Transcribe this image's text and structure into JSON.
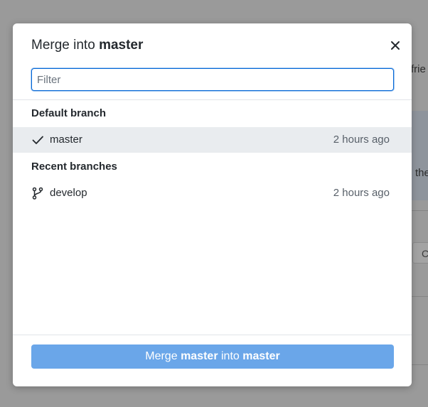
{
  "background": {
    "fragment_1": "frie",
    "fragment_2": "the",
    "fragment_3": "C"
  },
  "dialog": {
    "title_prefix": "Merge into",
    "title_branch": "master",
    "close_icon": "close-icon",
    "filter": {
      "value": "",
      "placeholder": "Filter"
    },
    "default_section": {
      "label": "Default branch",
      "branch": {
        "name": "master",
        "time": "2 hours ago",
        "icon": "check-icon",
        "selected": true
      }
    },
    "recent_section": {
      "label": "Recent branches",
      "branches": [
        {
          "name": "develop",
          "time": "2 hours ago",
          "icon": "git-branch-icon"
        }
      ]
    },
    "merge_button": {
      "word_merge": "Merge",
      "source": "master",
      "word_into": "into",
      "target": "master"
    }
  },
  "colors": {
    "accent": "#0366d6",
    "button_disabled": "#6aa6e9",
    "selected_row": "#e9ecef"
  }
}
